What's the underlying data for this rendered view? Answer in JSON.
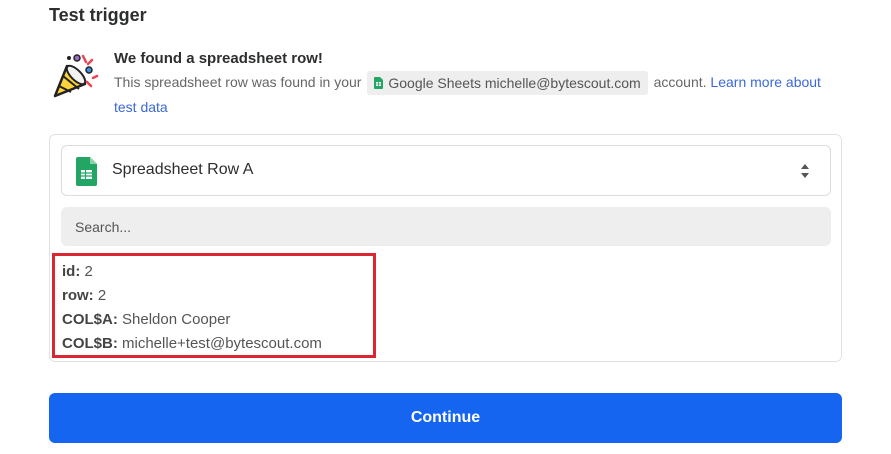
{
  "section": {
    "title": "Test trigger"
  },
  "found": {
    "title": "We found a spreadsheet row!",
    "desc_before": "This spreadsheet row was found in your",
    "app_chip": "Google Sheets michelle@bytescout.com",
    "desc_after": "account.",
    "learn_more": "Learn more about test data",
    "icon": "party-popper-icon"
  },
  "select": {
    "label": "Spreadsheet Row A",
    "icon": "google-sheets-icon"
  },
  "search": {
    "placeholder": "Search..."
  },
  "fields": [
    {
      "key": "id:",
      "value": "2"
    },
    {
      "key": "row:",
      "value": "2"
    },
    {
      "key": "COL$A:",
      "value": "Sheldon Cooper"
    },
    {
      "key": "COL$B:",
      "value": "michelle+test@bytescout.com"
    }
  ],
  "continue_label": "Continue",
  "colors": {
    "primary": "#1565f0",
    "highlight_border": "#d92632",
    "link": "#3b69d6",
    "sheets_green": "#23a566"
  }
}
